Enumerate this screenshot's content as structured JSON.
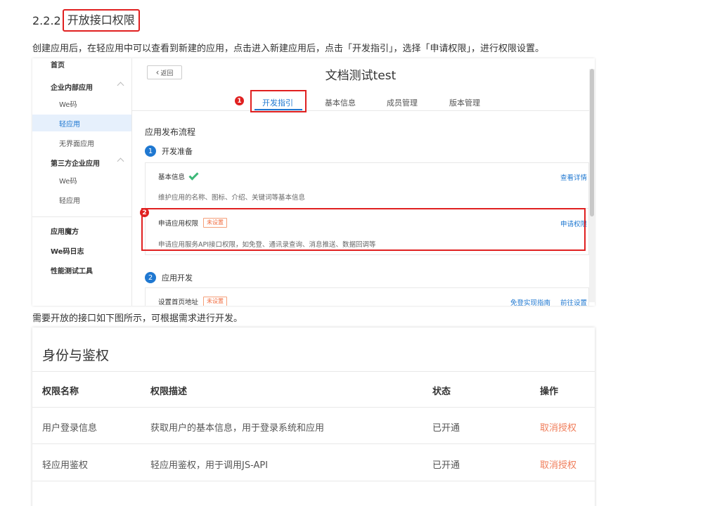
{
  "heading": {
    "number": "2.2.2",
    "title": "开放接口权限"
  },
  "paragraph1": "创建应用后，在轻应用中可以查看到新建的应用，点击进入新建应用后，点击「开发指引」，选择「申请权限」，进行权限设置。",
  "paragraph2": "需要开放的接口如下图所示，可根据需求进行开发。",
  "screenshot1": {
    "sidebar": {
      "home": "首页",
      "enterprise_group": "企业内部应用",
      "enterprise_items": [
        "We码",
        "轻应用",
        "无界面应用"
      ],
      "thirdparty_group": "第三方企业应用",
      "thirdparty_items": [
        "We码",
        "轻应用"
      ],
      "bottom_items": [
        "应用魔方",
        "We码日志",
        "性能测试工具"
      ]
    },
    "back_label": "返回",
    "app_title": "文档测试test",
    "tabs": [
      "开发指引",
      "基本信息",
      "成员管理",
      "版本管理"
    ],
    "markers": [
      "1",
      "2"
    ],
    "section_title": "应用发布流程",
    "steps": [
      {
        "num": "1",
        "label": "开发准备"
      },
      {
        "num": "2",
        "label": "应用开发"
      }
    ],
    "card_basic": {
      "name": "基本信息",
      "desc": "维护应用的名称、图标、介绍、关键词等基本信息",
      "link": "查看详情"
    },
    "card_permission": {
      "name": "申请应用权限",
      "tag": "未设置",
      "desc": "申请应用服务API接口权限，如免登、通讯录查询、消息推送、数据回调等",
      "link": "申请权限"
    },
    "card_homepage": {
      "name": "设置首页地址",
      "tag": "未设置",
      "link1": "免登实现指南",
      "link2": "前往设置"
    }
  },
  "screenshot2": {
    "title": "身份与鉴权",
    "columns": [
      "权限名称",
      "权限描述",
      "状态",
      "操作"
    ],
    "rows": [
      {
        "name": "用户登录信息",
        "desc": "获取用户的基本信息，用于登录系统和应用",
        "status": "已开通",
        "action": "取消授权"
      },
      {
        "name": "轻应用鉴权",
        "desc": "轻应用鉴权，用于调用JS-API",
        "status": "已开通",
        "action": "取消授权"
      }
    ]
  },
  "colors": {
    "accent": "#1f78d1",
    "highlight": "#e02020",
    "revoke": "#f07d5a",
    "tag": "#f06a3c"
  }
}
